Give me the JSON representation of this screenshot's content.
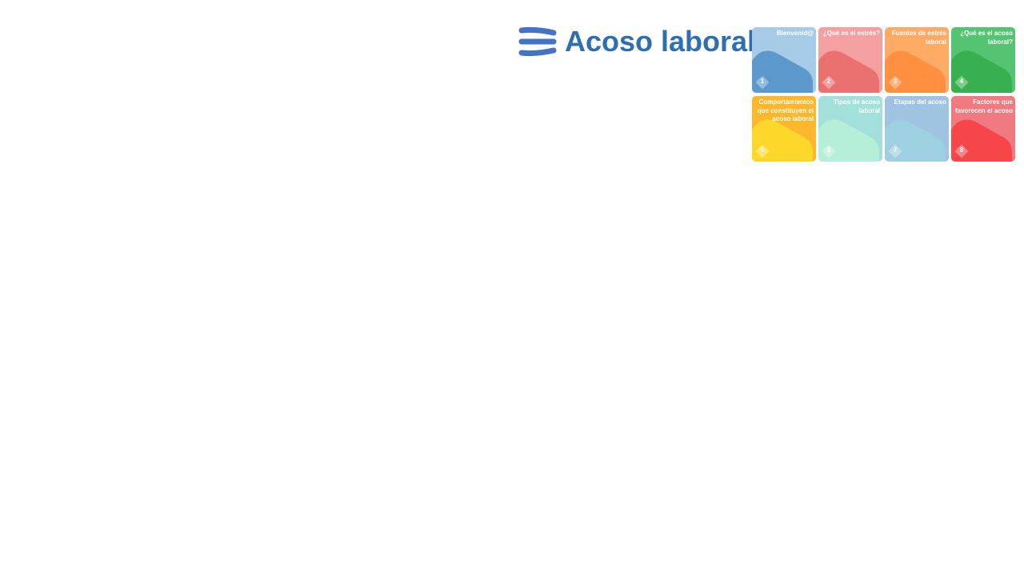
{
  "header": {
    "title": "Acoso laboral",
    "menu_icon": "hamburger-icon"
  },
  "tiles": [
    {
      "number": "1",
      "label": "Bienvenid@",
      "bg": "#a5cbe6",
      "fg": "#5b99cc"
    },
    {
      "number": "2",
      "label": "¿Qué es el estrés?",
      "bg": "#f4a0a0",
      "fg": "#eb7070"
    },
    {
      "number": "3",
      "label": "Fuentes de estrés laboral",
      "bg": "#ffab66",
      "fg": "#ff9040"
    },
    {
      "number": "4",
      "label": "¿Qué es el acoso laboral?",
      "bg": "#55c472",
      "fg": "#39b04f"
    },
    {
      "number": "5",
      "label": "Comportamientos que constituyen el acoso laboral",
      "bg": "#fdb72d",
      "fg": "#fdd72a"
    },
    {
      "number": "6",
      "label": "Tipos de acoso laboral",
      "bg": "#a3e0dc",
      "fg": "#b6efd8"
    },
    {
      "number": "7",
      "label": "Etapas del acoso",
      "bg": "#9fc3e0",
      "fg": "#9dd0e0"
    },
    {
      "number": "8",
      "label": "Factores que favorecen el acoso",
      "bg": "#f07a80",
      "fg": "#f7464a"
    }
  ]
}
